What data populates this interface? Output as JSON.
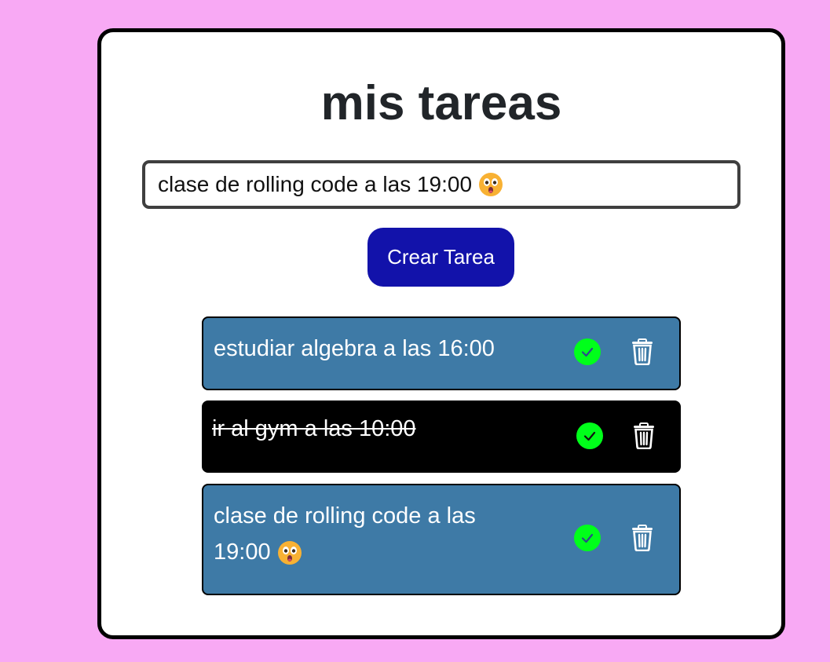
{
  "app": {
    "title": "mis tareas"
  },
  "form": {
    "input_value": "clase de rolling code a las 19:00",
    "input_emoji": "astonished-face-icon",
    "create_label": "Crear Tarea"
  },
  "tasks": [
    {
      "text": "estudiar algebra a las 16:00",
      "done": false,
      "emoji": ""
    },
    {
      "text": "ir al gym a las 10:00",
      "done": true,
      "emoji": ""
    },
    {
      "text": "clase de rolling code a las 19:00",
      "done": false,
      "emoji": "astonished-face-icon"
    }
  ],
  "colors": {
    "background": "#f8a9f4",
    "task_pending": "#3e7aa6",
    "task_done": "#000000",
    "button": "#1212aa",
    "check": "#00ff1a"
  }
}
